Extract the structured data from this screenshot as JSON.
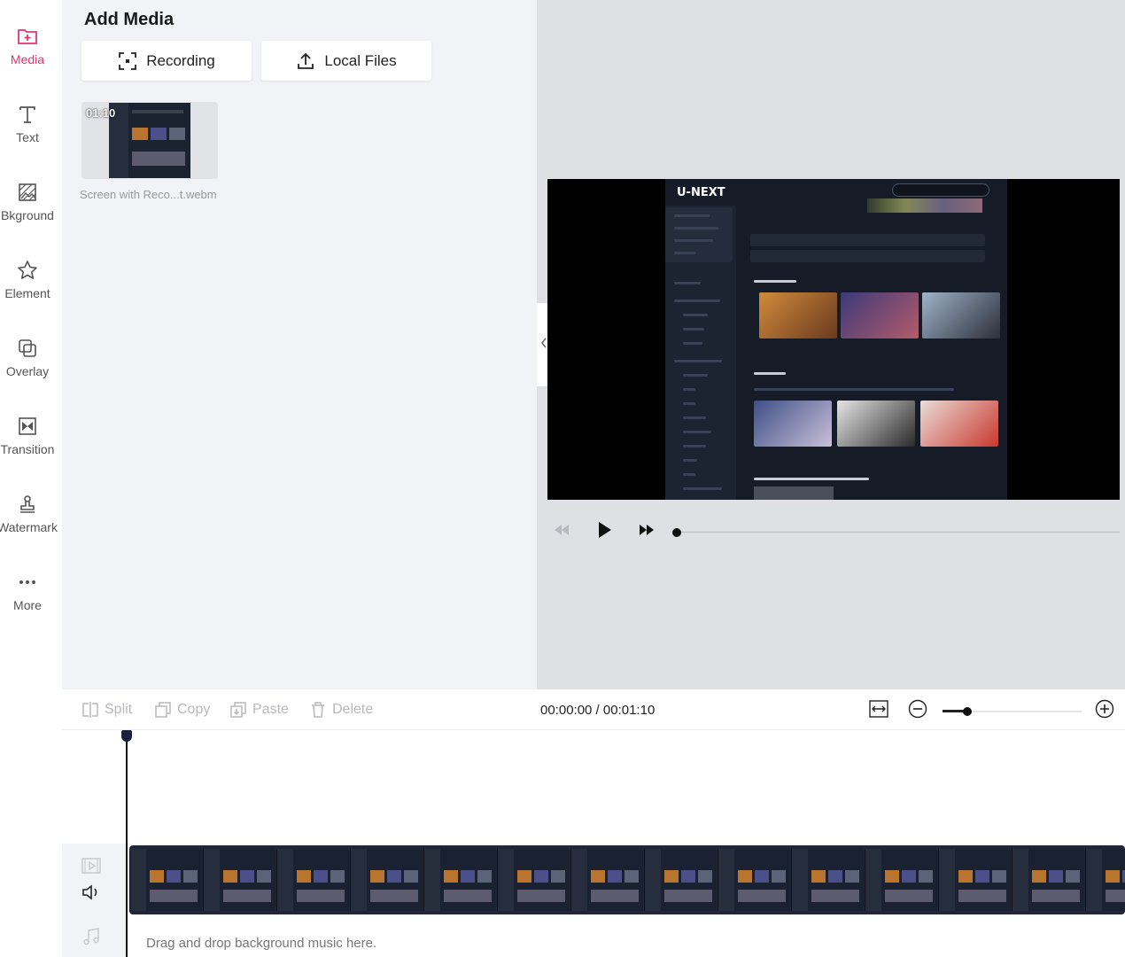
{
  "nav": {
    "items": [
      {
        "label": "Media",
        "icon": "media-folder-icon",
        "active": true
      },
      {
        "label": "Text",
        "icon": "text-icon"
      },
      {
        "label": "Bkground",
        "icon": "background-icon"
      },
      {
        "label": "Element",
        "icon": "star-icon"
      },
      {
        "label": "Overlay",
        "icon": "overlay-icon"
      },
      {
        "label": "Transition",
        "icon": "transition-icon"
      },
      {
        "label": "Watermark",
        "icon": "stamp-icon"
      },
      {
        "label": "More",
        "icon": "more-dots-icon"
      }
    ]
  },
  "media_panel": {
    "title": "Add Media",
    "recording_label": "Recording",
    "local_files_label": "Local Files",
    "items": [
      {
        "duration": "01:10",
        "name": "Screen with Reco...t.webm"
      }
    ]
  },
  "preview": {
    "video_logo": "U-NEXT",
    "playback_position": 0
  },
  "timeline": {
    "split_label": "Split",
    "copy_label": "Copy",
    "paste_label": "Paste",
    "delete_label": "Delete",
    "time_readout": "00:00:00 / 00:01:10",
    "music_hint": "Drag and drop background music here."
  },
  "colors": {
    "accent": "#e8336d",
    "panel_bg": "#f2f3f6",
    "preview_bg": "#dfe0e4"
  }
}
